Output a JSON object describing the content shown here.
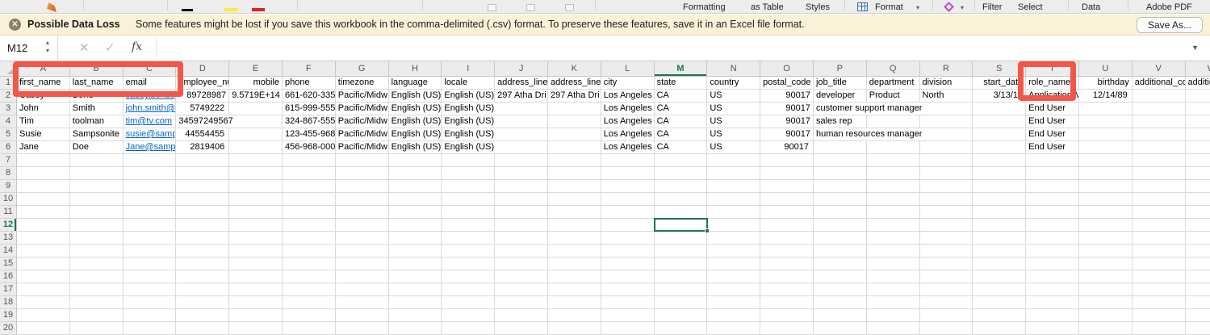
{
  "ribbon": {
    "labels": [
      "Formatting",
      "as Table",
      "Styles",
      "Format",
      "Filter",
      "Select",
      "Data",
      "Adobe PDF"
    ]
  },
  "banner": {
    "icon": "x-circle-icon",
    "title": "Possible Data Loss",
    "message": "Some features might be lost if you save this workbook in the comma-delimited (.csv) format. To preserve these features, save it in an Excel file format.",
    "save_as_button": "Save As..."
  },
  "formula_bar": {
    "cell_reference": "M12",
    "fx_label": "fx",
    "formula_value": ""
  },
  "sheet": {
    "column_headers": [
      "A",
      "B",
      "C",
      "D",
      "E",
      "F",
      "G",
      "H",
      "I",
      "J",
      "K",
      "L",
      "M",
      "N",
      "O",
      "P",
      "Q",
      "R",
      "S",
      "T",
      "U",
      "V",
      "W"
    ],
    "visible_row_count": 20,
    "selected_cell": {
      "reference": "M12",
      "column": "M",
      "row": 12
    },
    "grid": {
      "1": [
        "first_name",
        "last_name",
        "email",
        "employee_nur",
        "mobile",
        "phone",
        "timezone",
        "language",
        "locale",
        "address_line",
        "address_line",
        "city",
        "state",
        "country",
        "postal_code",
        "job_title",
        "department",
        "division",
        "start_date",
        "role_name",
        "birthday",
        "additional_co",
        "addition"
      ],
      "2": [
        "Casey",
        "Bond",
        "casey.bond@",
        "89728987",
        "9.5719E+14",
        "661-620-335",
        "Pacific/Midw",
        "English (US)",
        "English (US)",
        "297 Atha Dri",
        "297 Atha Dri",
        "Los Angeles",
        "CA",
        "US",
        "90017",
        "developer",
        "Product",
        "North",
        "3/13/10",
        "Application M",
        "12/14/89",
        "",
        ""
      ],
      "3": [
        "John",
        "Smith",
        "john.smith@",
        "5749222",
        "",
        "615-999-555",
        "Pacific/Midw",
        "English (US)",
        "English (US)",
        "",
        "",
        "Los Angeles",
        "CA",
        "US",
        "90017",
        "customer support manager",
        "",
        "",
        "",
        "End User",
        "",
        "",
        ""
      ],
      "4": [
        "Tim",
        "toolman",
        "tim@tv.com",
        "34597249567",
        "",
        "324-867-555",
        "Pacific/Midw",
        "English (US)",
        "English (US)",
        "",
        "",
        "Los Angeles",
        "CA",
        "US",
        "90017",
        "sales rep",
        "",
        "",
        "",
        "End User",
        "",
        "",
        ""
      ],
      "5": [
        "Susie",
        "Sampsonite",
        "susie@samp",
        "44554455",
        "",
        "123-455-968",
        "Pacific/Midw",
        "English (US)",
        "English (US)",
        "",
        "",
        "Los Angeles",
        "CA",
        "US",
        "90017",
        "human resources manager",
        "",
        "",
        "",
        "End User",
        "",
        "",
        ""
      ],
      "6": [
        "Jane",
        "Doe",
        "Jane@sampl",
        "2819406",
        "",
        "456-968-000",
        "Pacific/Midw",
        "English (US)",
        "English (US)",
        "",
        "",
        "Los Angeles",
        "CA",
        "US",
        "90017",
        "",
        "",
        "",
        "",
        "End User",
        "",
        "",
        ""
      ]
    }
  },
  "annotations": {
    "highlight_color": "#f25749",
    "boxes": [
      "columns-a-to-c-with-row1",
      "column-t-role-name"
    ]
  },
  "colors": {
    "selection_green": "#217346",
    "banner_background": "#faf1d8",
    "link_blue": "#0563c1"
  }
}
